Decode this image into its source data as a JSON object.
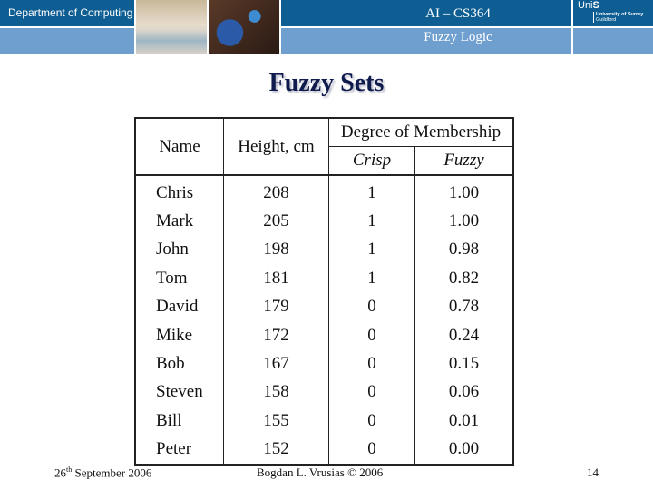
{
  "header": {
    "department": "Department of Computing",
    "course": "AI – CS364",
    "topic": "Fuzzy Logic",
    "logo": {
      "uni_prefix": "Uni",
      "uni_suffix": "S",
      "university": "University of Surrey",
      "location": "Guildford"
    }
  },
  "slide": {
    "title": "Fuzzy Sets"
  },
  "table": {
    "headers": {
      "name": "Name",
      "height": "Height, cm",
      "group": "Degree of Membership",
      "crisp": "Crisp",
      "fuzzy": "Fuzzy"
    },
    "rows": [
      {
        "name": "Chris",
        "height": "208",
        "crisp": "1",
        "fuzzy": "1.00"
      },
      {
        "name": "Mark",
        "height": "205",
        "crisp": "1",
        "fuzzy": "1.00"
      },
      {
        "name": "John",
        "height": "198",
        "crisp": "1",
        "fuzzy": "0.98"
      },
      {
        "name": "Tom",
        "height": "181",
        "crisp": "1",
        "fuzzy": "0.82"
      },
      {
        "name": "David",
        "height": "179",
        "crisp": "0",
        "fuzzy": "0.78"
      },
      {
        "name": "Mike",
        "height": "172",
        "crisp": "0",
        "fuzzy": "0.24"
      },
      {
        "name": "Bob",
        "height": "167",
        "crisp": "0",
        "fuzzy": "0.15"
      },
      {
        "name": "Steven",
        "height": "158",
        "crisp": "0",
        "fuzzy": "0.06"
      },
      {
        "name": "Bill",
        "height": "155",
        "crisp": "0",
        "fuzzy": "0.01"
      },
      {
        "name": "Peter",
        "height": "152",
        "crisp": "0",
        "fuzzy": "0.00"
      }
    ]
  },
  "footer": {
    "date_day": "26",
    "date_suffix": "th",
    "date_rest": " September 2006",
    "author": "Bogdan L. Vrusias © 2006",
    "page": "14"
  }
}
